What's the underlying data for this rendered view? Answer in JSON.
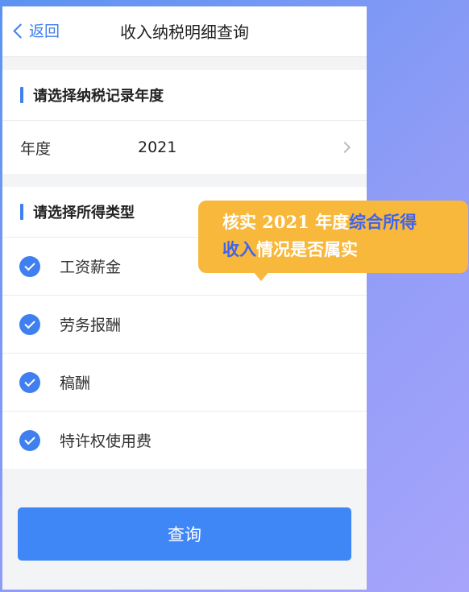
{
  "nav": {
    "back_label": "返回",
    "title": "收入纳税明细查询"
  },
  "year_section": {
    "title": "请选择纳税记录年度",
    "row_label": "年度",
    "row_value": "2021"
  },
  "type_section": {
    "title": "请选择所得类型",
    "items": [
      {
        "label": "工资薪金",
        "checked": true
      },
      {
        "label": "劳务报酬",
        "checked": true
      },
      {
        "label": "稿酬",
        "checked": true
      },
      {
        "label": "特许权使用费",
        "checked": true
      }
    ]
  },
  "query_button": {
    "label": "查询"
  },
  "callout": {
    "line1_a": "核实 2021 年度",
    "line1_hl": "综合所得",
    "line2_hl": "收入",
    "line2_b": "情况是否属实"
  },
  "colors": {
    "accent": "#3f86f6",
    "callout_bg": "#f7b83c",
    "callout_highlight": "#3f63ee"
  }
}
